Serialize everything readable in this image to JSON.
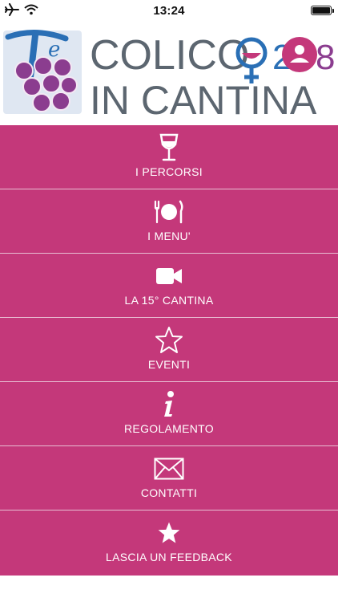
{
  "status_bar": {
    "time": "13:24",
    "icons": [
      "airplane-icon",
      "wifi-icon",
      "battery-icon"
    ]
  },
  "header": {
    "title_line1": "COLICO",
    "title_line2": "IN CANTINA",
    "year_digits": [
      "2",
      "8"
    ],
    "logo_letter": "e",
    "colors": {
      "title": "#5c6670",
      "accent": "#c4387a",
      "grapes": "#8b3d8f",
      "logo_blue": "#2a6fb5"
    }
  },
  "menu": {
    "background": "#c4387a",
    "items": [
      {
        "label": "I PERCORSI",
        "icon": "wine-glass-icon"
      },
      {
        "label": "I MENU'",
        "icon": "plate-cutlery-icon"
      },
      {
        "label": "LA 15° CANTINA",
        "icon": "video-camera-icon"
      },
      {
        "label": "EVENTI",
        "icon": "star-outline-icon"
      },
      {
        "label": "REGOLAMENTO",
        "icon": "info-icon"
      },
      {
        "label": "CONTATTI",
        "icon": "envelope-icon"
      },
      {
        "label": "LASCIA UN FEEDBACK",
        "icon": "star-filled-icon"
      }
    ]
  }
}
